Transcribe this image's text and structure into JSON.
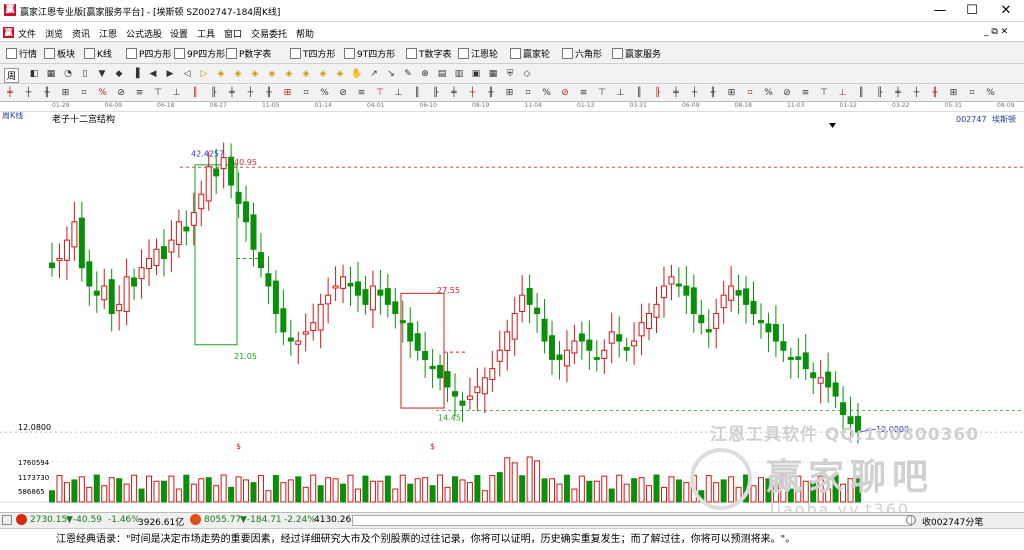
{
  "window": {
    "title": "赢家江恩专业版[赢家服务平台] - [埃斯顿  SZ002747-184周K线]",
    "min": "—",
    "max": "☐",
    "close": "✕"
  },
  "menu": [
    "文件",
    "浏览",
    "资讯",
    "江恩",
    "公式选股",
    "设置",
    "工具",
    "窗口",
    "交易委托",
    "帮助"
  ],
  "mdi_buttons": "_ ⧉ ✕",
  "toolbar1": [
    {
      "label": "行情",
      "icon": "grid-icon"
    },
    {
      "label": "板块",
      "icon": "blocks-icon"
    },
    {
      "label": "K线",
      "icon": "candle-icon"
    },
    {
      "label": "P四方形",
      "icon": "p-square-icon"
    },
    {
      "label": "9P四方形",
      "icon": "9p-square-icon"
    },
    {
      "label": "P数字表",
      "icon": "p-table-icon"
    },
    {
      "label": "T四方形",
      "icon": "t-square-icon"
    },
    {
      "label": "9T四方形",
      "icon": "9t-square-icon"
    },
    {
      "label": "T数字表",
      "icon": "t-table-icon"
    },
    {
      "label": "江恩轮",
      "icon": "gann-wheel-icon"
    },
    {
      "label": "赢家轮",
      "icon": "winner-wheel-icon"
    },
    {
      "label": "六角形",
      "icon": "hexagon-icon"
    },
    {
      "label": "赢家服务",
      "icon": "service-icon"
    }
  ],
  "period_select": "周",
  "chart": {
    "period_label": "周K线",
    "indicator_name": "老子十二宫结构",
    "code": "002747",
    "name": "埃斯顿",
    "dates": [
      "01-29",
      "04-09",
      "06-18",
      "08-27",
      "11-05",
      "01-14",
      "04-01",
      "06-10",
      "08-19",
      "11-04",
      "01-13",
      "03-31",
      "06-09",
      "08-18",
      "11-03",
      "01-12",
      "03-22",
      "05-31",
      "08-09"
    ],
    "labels": {
      "high": "42.4257",
      "ref": "40.95",
      "box1_low": "21.05",
      "box2_high": "27.55",
      "box2_low": "14.45",
      "last_low": "12.0800",
      "axis_low": "12.0800"
    },
    "volume_ticks": [
      "1760594",
      "1173730",
      "586865"
    ],
    "dollar_mark": "$"
  },
  "chart_data": {
    "type": "candlestick",
    "y_range": [
      11,
      45
    ],
    "close": [
      30,
      31,
      33,
      35,
      30,
      28,
      27,
      28,
      25,
      26,
      29,
      28,
      30,
      31,
      32,
      31,
      33,
      35,
      34,
      36,
      38,
      41,
      40,
      42,
      39,
      37,
      35,
      32,
      30,
      28,
      25,
      23,
      22,
      22,
      23,
      24,
      26,
      27,
      28,
      29,
      28,
      27,
      26,
      28,
      27,
      26,
      25,
      24,
      22,
      21,
      20,
      19,
      18,
      17,
      16,
      15,
      16,
      17,
      18,
      19,
      21,
      23,
      25,
      27,
      26,
      25,
      22,
      20,
      20,
      21,
      22,
      22,
      21,
      20,
      21,
      23,
      22,
      21,
      22,
      24,
      25,
      26,
      28,
      29,
      28,
      27,
      25,
      24,
      23,
      25,
      27,
      28,
      27,
      26,
      25,
      24,
      23,
      22,
      21,
      20,
      20,
      19,
      18,
      18,
      17,
      16,
      14,
      13,
      12.08
    ],
    "volume_peaks": [
      "1760594"
    ]
  },
  "status": {
    "sh_index": "2730.15",
    "sh_change": "▼-40.59",
    "sh_pct": "-1.46%",
    "sh_amount": "3926.61亿",
    "sz_index": "8055.77",
    "sz_change": "▼-184.71",
    "sz_pct": "-2.24%",
    "sz_amount": "4130.26",
    "right": "收002747分笔"
  },
  "quote": "江恩经典语录：\"时间是决定市场走势的重要因素，经过详细研究大市及个别股票的过往记录，你将可以证明，历史确实重复发生；而了解过往，你将可以预测将来。\"。",
  "watermark": {
    "line1": "江恩工具软件  QQ:100800360",
    "line2": "赢家聊吧",
    "line3": "liaoba.yy.t360"
  },
  "colors": {
    "up": "#d01818",
    "down": "#0a8f0a",
    "box_red": "#d02020",
    "box_green": "#19a019",
    "dash_red": "#d03030",
    "dash_green": "#21a021",
    "label_blue": "#3030c0"
  }
}
